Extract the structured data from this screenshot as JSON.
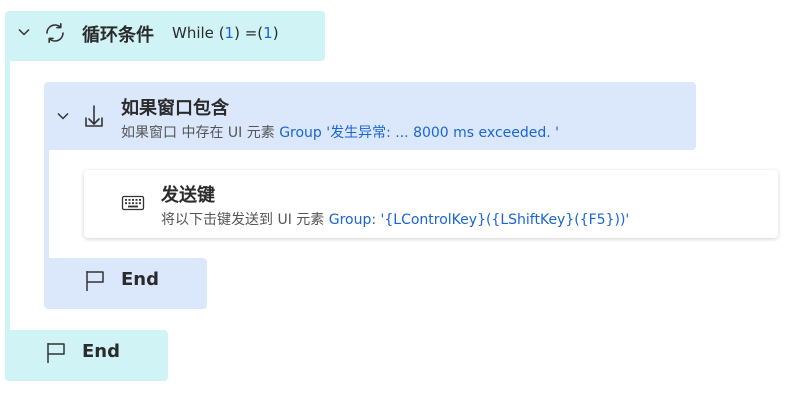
{
  "loop": {
    "title": "循环条件",
    "kw": "While",
    "open1": "(",
    "v1": "1",
    "close1": ")",
    "eq": " =(",
    "v2": "1",
    "close2": ")",
    "end_label": "End"
  },
  "if_window": {
    "title": "如果窗口包含",
    "sub_prefix": "如果窗口  中存在 UI 元素 ",
    "sub_value": "Group '发生异常:  ...  8000 ms exceeded. '",
    "end_label": "End"
  },
  "send_keys": {
    "title": "发送键",
    "sub_prefix": "将以下击键发送到 UI 元素 ",
    "sub_value": "Group: '{LControlKey}({LShiftKey}({F5}))'"
  },
  "icons": {
    "chevron": "chevron-down-icon",
    "loop": "loop-icon",
    "if_window": "if-window-icon",
    "keyboard": "keyboard-icon",
    "flag": "flag-icon"
  },
  "colors": {
    "loop_bg": "#d0f4f6",
    "if_bg": "#dbe8fc",
    "link_blue": "#1a64d6"
  }
}
